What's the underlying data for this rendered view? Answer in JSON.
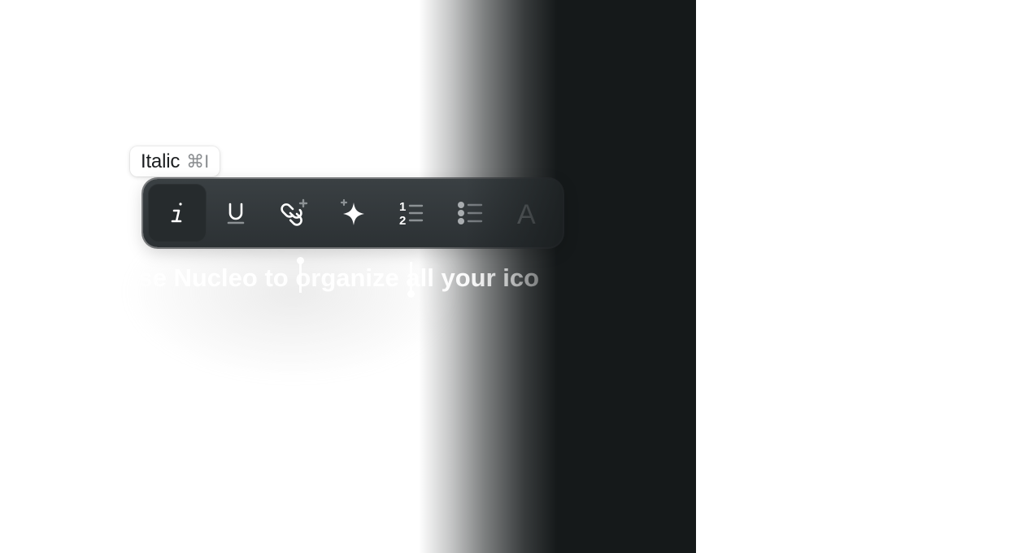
{
  "tooltip": {
    "label": "Italic",
    "shortcut": "⌘I"
  },
  "toolbar": {
    "buttons": [
      {
        "name": "italic",
        "icon": "italic-icon",
        "active": true
      },
      {
        "name": "underline",
        "icon": "underline-icon",
        "active": false
      },
      {
        "name": "add-link",
        "icon": "link-plus-icon",
        "active": false
      },
      {
        "name": "ai-sparkle",
        "icon": "sparkle-icon",
        "active": false
      },
      {
        "name": "numbered-list",
        "icon": "numbered-list-icon",
        "active": false
      },
      {
        "name": "bulleted-list",
        "icon": "bulleted-list-icon",
        "active": false
      },
      {
        "name": "text-style",
        "icon": "text-color-icon",
        "active": false
      }
    ],
    "numbered_list_glyphs": [
      "1",
      "2"
    ],
    "text_style_glyph": "A"
  },
  "editor": {
    "text": "Use Nucleo to organize all your ico"
  },
  "colors": {
    "toolbar_bg": "#2f3437",
    "dark_panel": "#15191a",
    "icon": "#ffffff",
    "icon_muted": "#8c9194"
  }
}
